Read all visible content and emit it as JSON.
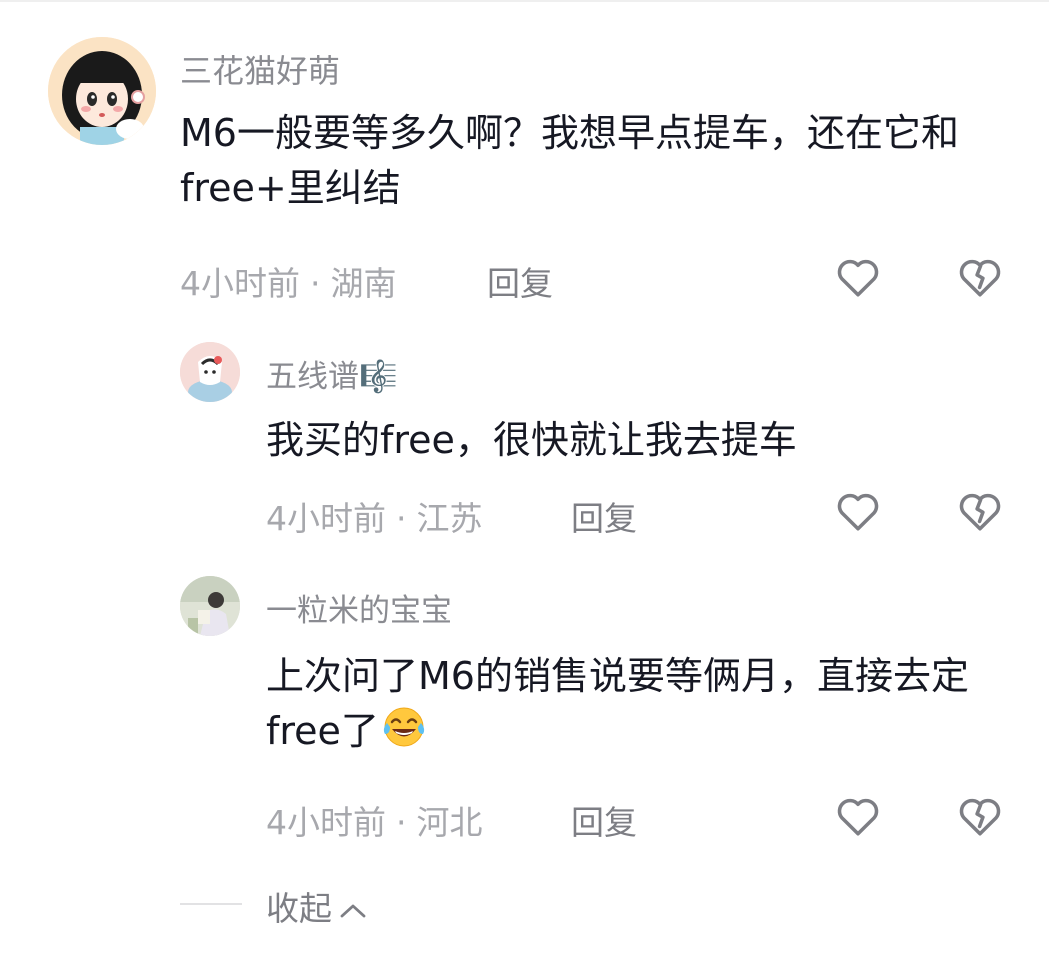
{
  "comments": [
    {
      "username": "三花猫好萌",
      "text": "M6一般要等多久啊？我想早点提车，还在它和free+里纠结",
      "time": "4小时前",
      "separator": "·",
      "location": "湖南",
      "reply_label": "回复",
      "avatar_icon": "cartoon-girl-avatar",
      "replies": [
        {
          "username": "五线谱🎼",
          "text": "我买的free，很快就让我去提车",
          "time": "4小时前",
          "separator": "·",
          "location": "江苏",
          "reply_label": "回复",
          "avatar_icon": "cartoon-avatar"
        },
        {
          "username": "一粒米的宝宝",
          "text": "上次问了M6的销售说要等俩月，直接去定free了",
          "text_emoji": "😂",
          "time": "4小时前",
          "separator": "·",
          "location": "河北",
          "reply_label": "回复",
          "avatar_icon": "photo-avatar"
        }
      ]
    }
  ],
  "collapse_label": "收起",
  "icons": {
    "like": "heart-outline-icon",
    "dislike": "broken-heart-icon",
    "collapse": "chevron-up-icon"
  },
  "colors": {
    "text_primary": "#161823",
    "text_secondary": "#8a8b91",
    "meta": "#a7a8ad",
    "icon": "#7d7e84"
  }
}
